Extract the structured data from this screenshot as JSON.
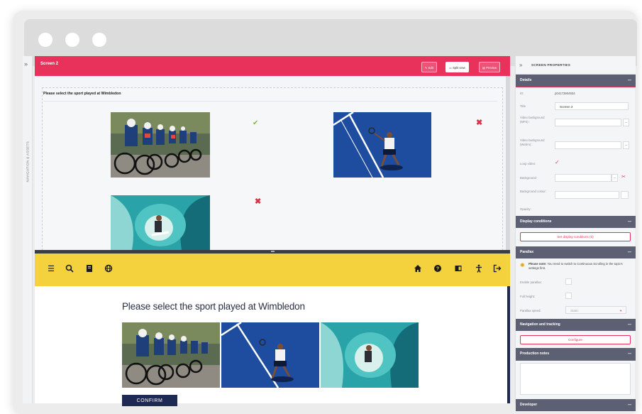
{
  "window": {
    "controls": [
      "close",
      "minimize",
      "maximize"
    ]
  },
  "left_rail": {
    "toggle_icon": "»",
    "label": "NAVIGATION & ASSETS"
  },
  "editor": {
    "screen_title": "Screen 2",
    "view_buttons": [
      {
        "label": "Edit",
        "icon": "pencil-icon"
      },
      {
        "label": "Split view",
        "icon": "split-icon"
      },
      {
        "label": "Preview",
        "icon": "preview-icon"
      }
    ],
    "question": "Please select the sport played at Wimbledon",
    "answers": [
      {
        "image": "cycling",
        "mark": "✔",
        "correct": true
      },
      {
        "image": "tennis",
        "mark": "✖",
        "correct": false
      },
      {
        "image": "surfing",
        "mark": "✖",
        "correct": false
      }
    ]
  },
  "preview": {
    "toolbar_icons_left": [
      "menu-icon",
      "search-icon",
      "book-icon",
      "globe-icon"
    ],
    "toolbar_icons_right": [
      "home-icon",
      "help-icon",
      "contents-icon",
      "accessibility-icon",
      "exit-icon"
    ],
    "question": "Please select the sport played at Wimbledon",
    "confirm_label": "CONFIRM"
  },
  "properties": {
    "toggle_icon": "»",
    "title": "SCREEN PROPERTIES",
    "details": {
      "header": "Details",
      "id_label": "ID:",
      "id_value": "p04173904934",
      "title_label": "Title",
      "title_value": "Screen 2",
      "video_mp4_label": "Video background (MP4) :",
      "video_webm_label": "Video background (Webm) :",
      "loop_label": "Loop video:",
      "loop_checked": true,
      "background_label": "Background",
      "bgcolour_label": "Background colour:",
      "opacity_label": "Opacity:"
    },
    "display_conditions": {
      "header": "Display conditions",
      "button": "Set display conditions (0)"
    },
    "parallax": {
      "header": "Parallax",
      "note_strong": "Please note:",
      "note_text": " You need to switch to Continuous Scrolling in the topic's settings first.",
      "enable_label": "Enable parallax:",
      "full_height_label": "Full height:",
      "speed_label": "Parallax speed:",
      "speed_value": "Static"
    },
    "navigation": {
      "header": "Navigation and tracking",
      "button": "Configure"
    },
    "production_notes": {
      "header": "Production notes"
    },
    "developer": {
      "header": "Developer"
    },
    "collapse_symbol": "–",
    "colors": {
      "accent": "#e8325b",
      "section": "#5c6072",
      "preview_bar": "#f3d23d",
      "navy": "#1f2a54"
    }
  }
}
